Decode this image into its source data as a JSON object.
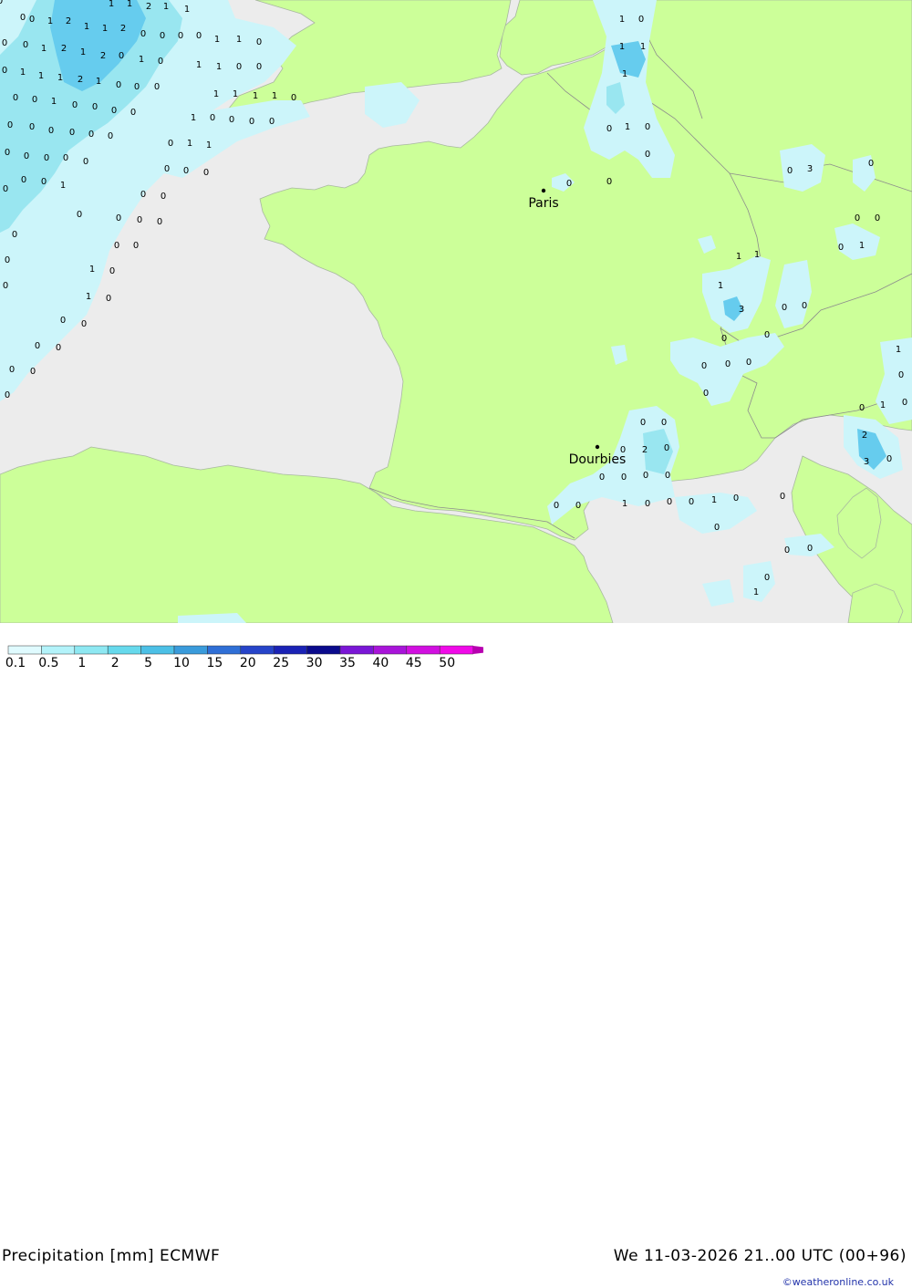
{
  "title": "Precipitation [mm] ECMWF",
  "timestamp": "We 11-03-2026 21..00 UTC (00+96)",
  "credit": "©weatheronline.co.uk",
  "colors": {
    "sea": "#ececec",
    "land": "#ccff99",
    "border": "#999999",
    "precip_light": "#ccf5fa",
    "precip_mid": "#99e6f0",
    "precip_heavy": "#66ccee"
  },
  "cities": [
    {
      "name": "Paris"
    },
    {
      "name": "Dourbies"
    }
  ],
  "legend": {
    "labels": [
      "0.1",
      "0.5",
      "1",
      "2",
      "5",
      "10",
      "15",
      "20",
      "25",
      "30",
      "35",
      "40",
      "45",
      "50"
    ],
    "colors": [
      "#e0fbff",
      "#b3f3fa",
      "#8ee8f2",
      "#66d9ec",
      "#4cc0e6",
      "#3a9bdb",
      "#2f6fd6",
      "#2644c9",
      "#1a22b5",
      "#0a0a8c",
      "#7a16d6",
      "#a814d9",
      "#d10fe0",
      "#f00ae8",
      "#b800b0"
    ]
  },
  "precip_values": [
    {
      "v": "1"
    },
    {
      "v": "1"
    },
    {
      "v": "2"
    },
    {
      "v": "1"
    },
    {
      "v": "1"
    },
    {
      "v": "0"
    },
    {
      "v": "0"
    },
    {
      "v": "1"
    },
    {
      "v": "2"
    },
    {
      "v": "1"
    },
    {
      "v": "1"
    },
    {
      "v": "2"
    },
    {
      "v": "0"
    },
    {
      "v": "0"
    },
    {
      "v": "0"
    },
    {
      "v": "0"
    },
    {
      "v": "1"
    },
    {
      "v": "1"
    },
    {
      "v": "0"
    },
    {
      "v": "0"
    },
    {
      "v": "0"
    },
    {
      "v": "1"
    },
    {
      "v": "2"
    },
    {
      "v": "1"
    },
    {
      "v": "2"
    },
    {
      "v": "0"
    },
    {
      "v": "1"
    },
    {
      "v": "0"
    },
    {
      "v": "1"
    },
    {
      "v": "1"
    },
    {
      "v": "0"
    },
    {
      "v": "0"
    },
    {
      "v": "0"
    },
    {
      "v": "1"
    },
    {
      "v": "1"
    },
    {
      "v": "1"
    },
    {
      "v": "2"
    },
    {
      "v": "1"
    },
    {
      "v": "0"
    },
    {
      "v": "0"
    },
    {
      "v": "0"
    },
    {
      "v": "1"
    },
    {
      "v": "1"
    },
    {
      "v": "1"
    },
    {
      "v": "1"
    },
    {
      "v": "0"
    },
    {
      "v": "0"
    },
    {
      "v": "0"
    },
    {
      "v": "1"
    },
    {
      "v": "0"
    },
    {
      "v": "0"
    },
    {
      "v": "0"
    },
    {
      "v": "0"
    },
    {
      "v": "1"
    },
    {
      "v": "0"
    },
    {
      "v": "0"
    },
    {
      "v": "0"
    },
    {
      "v": "0"
    },
    {
      "v": "0"
    },
    {
      "v": "0"
    },
    {
      "v": "0"
    },
    {
      "v": "0"
    },
    {
      "v": "0"
    },
    {
      "v": "0"
    },
    {
      "v": "1"
    },
    {
      "v": "1"
    },
    {
      "v": "0"
    },
    {
      "v": "0"
    },
    {
      "v": "0"
    },
    {
      "v": "0"
    },
    {
      "v": "0"
    },
    {
      "v": "0"
    },
    {
      "v": "0"
    },
    {
      "v": "0"
    },
    {
      "v": "0"
    },
    {
      "v": "0"
    },
    {
      "v": "0"
    },
    {
      "v": "1"
    },
    {
      "v": "0"
    },
    {
      "v": "0"
    },
    {
      "v": "0"
    },
    {
      "v": "0"
    },
    {
      "v": "0"
    },
    {
      "v": "0"
    },
    {
      "v": "0"
    },
    {
      "v": "0"
    },
    {
      "v": "0"
    },
    {
      "v": "0"
    },
    {
      "v": "0"
    },
    {
      "v": "1"
    },
    {
      "v": "0"
    },
    {
      "v": "0"
    },
    {
      "v": "1"
    },
    {
      "v": "0"
    },
    {
      "v": "0"
    },
    {
      "v": "0"
    },
    {
      "v": "0"
    },
    {
      "v": "0"
    },
    {
      "v": "0"
    },
    {
      "v": "0"
    },
    {
      "v": "0"
    },
    {
      "v": "1"
    },
    {
      "v": "0"
    },
    {
      "v": "1"
    },
    {
      "v": "1"
    },
    {
      "v": "1"
    },
    {
      "v": "0"
    },
    {
      "v": "1"
    },
    {
      "v": "0"
    },
    {
      "v": "0"
    },
    {
      "v": "0"
    },
    {
      "v": "0"
    },
    {
      "v": "0"
    },
    {
      "v": "3"
    },
    {
      "v": "0"
    },
    {
      "v": "0"
    },
    {
      "v": "0"
    },
    {
      "v": "0"
    },
    {
      "v": "1"
    },
    {
      "v": "1"
    },
    {
      "v": "1"
    },
    {
      "v": "1"
    },
    {
      "v": "3"
    },
    {
      "v": "0"
    },
    {
      "v": "0"
    },
    {
      "v": "0"
    },
    {
      "v": "0"
    },
    {
      "v": "0"
    },
    {
      "v": "0"
    },
    {
      "v": "0"
    },
    {
      "v": "0"
    },
    {
      "v": "1"
    },
    {
      "v": "0"
    },
    {
      "v": "0"
    },
    {
      "v": "1"
    },
    {
      "v": "0"
    },
    {
      "v": "2"
    },
    {
      "v": "3"
    },
    {
      "v": "0"
    },
    {
      "v": "0"
    },
    {
      "v": "0"
    },
    {
      "v": "0"
    },
    {
      "v": "2"
    },
    {
      "v": "0"
    },
    {
      "v": "0"
    },
    {
      "v": "0"
    },
    {
      "v": "0"
    },
    {
      "v": "0"
    },
    {
      "v": "0"
    },
    {
      "v": "0"
    },
    {
      "v": "1"
    },
    {
      "v": "0"
    },
    {
      "v": "0"
    },
    {
      "v": "0"
    },
    {
      "v": "1"
    },
    {
      "v": "0"
    },
    {
      "v": "0"
    },
    {
      "v": "0"
    },
    {
      "v": "0"
    },
    {
      "v": "0"
    },
    {
      "v": "0"
    },
    {
      "v": "1"
    },
    {
      "v": "0"
    }
  ]
}
